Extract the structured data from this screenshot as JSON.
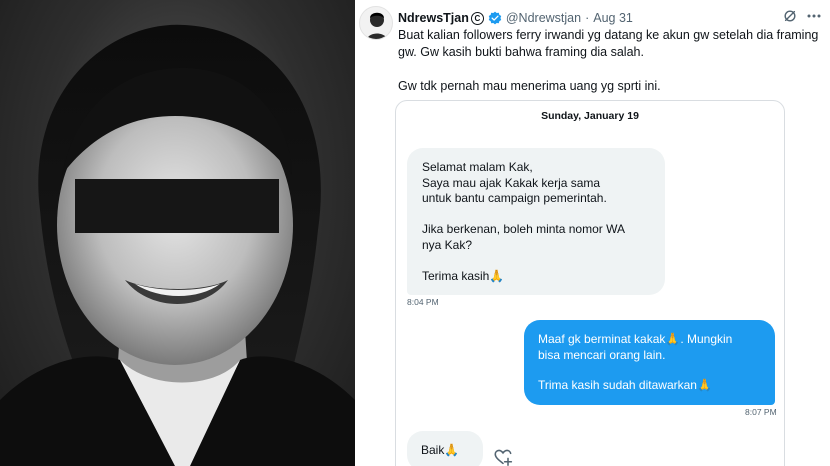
{
  "photo": {
    "description_icon": "person-photo"
  },
  "tweet": {
    "display_name": "NdrewsTjan",
    "badge_text": "C",
    "handle": "@Ndrewstjan",
    "separator": "·",
    "date": "Aug 31",
    "text_lines": [
      "Buat kalian followers ferry irwandi yg datang ke akun gw setelah dia framing",
      "gw. Gw kasih bukti bahwa framing dia salah.",
      "Gw tdk pernah mau menerima uang yg sprti ini."
    ]
  },
  "chat": {
    "date_label": "Sunday, January 19",
    "incoming": {
      "lines": [
        "Selamat malam Kak,",
        "Saya mau ajak Kakak kerja sama",
        "untuk bantu campaign pemerintah.",
        "",
        "Jika berkenan, boleh minta nomor WA",
        "nya Kak?",
        "",
        "Terima kasih🙏"
      ],
      "time": "8:04 PM"
    },
    "outgoing": {
      "lines": [
        "Maaf gk berminat kakak🙏. Mungkin",
        "bisa mencari orang lain.",
        "",
        "Trima kasih sudah ditawarkan🙏"
      ],
      "time": "8:07 PM"
    },
    "incoming2": {
      "text": "Baik🙏"
    }
  },
  "colors": {
    "accent": "#1d9bf0",
    "bubble_gray": "#eff3f4",
    "text": "#0f1419",
    "muted": "#536471"
  }
}
